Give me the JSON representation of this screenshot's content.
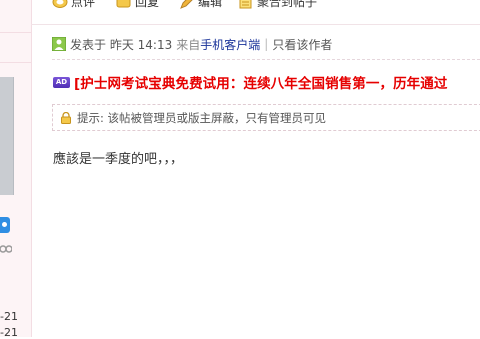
{
  "actions": [
    {
      "label": "点评",
      "icon": "comment-icon"
    },
    {
      "label": "回复",
      "icon": "reply-icon"
    },
    {
      "label": "编辑",
      "icon": "edit-icon"
    },
    {
      "label": "聚合到帖子",
      "icon": "merge-icon"
    }
  ],
  "post": {
    "posted_prefix": "发表于",
    "posted_time": "昨天 14:13",
    "from_prefix": "来自",
    "client_link": "手机客户端",
    "separator": "|",
    "only_author": "只看该作者"
  },
  "ad": {
    "badge": "AD",
    "text": "[护士网考试宝典免费试用：连续八年全国销售第一，历年通过"
  },
  "notice": {
    "text": "提示: 该帖被管理员或版主屏蔽，只有管理员可见"
  },
  "content": "應該是一季度的吧，，，",
  "left_column": {
    "dates": [
      "-21",
      "-21"
    ]
  },
  "colors": {
    "accent_red": "#e60000",
    "link_blue": "#1a3399",
    "left_bg": "#fdf4f6"
  }
}
